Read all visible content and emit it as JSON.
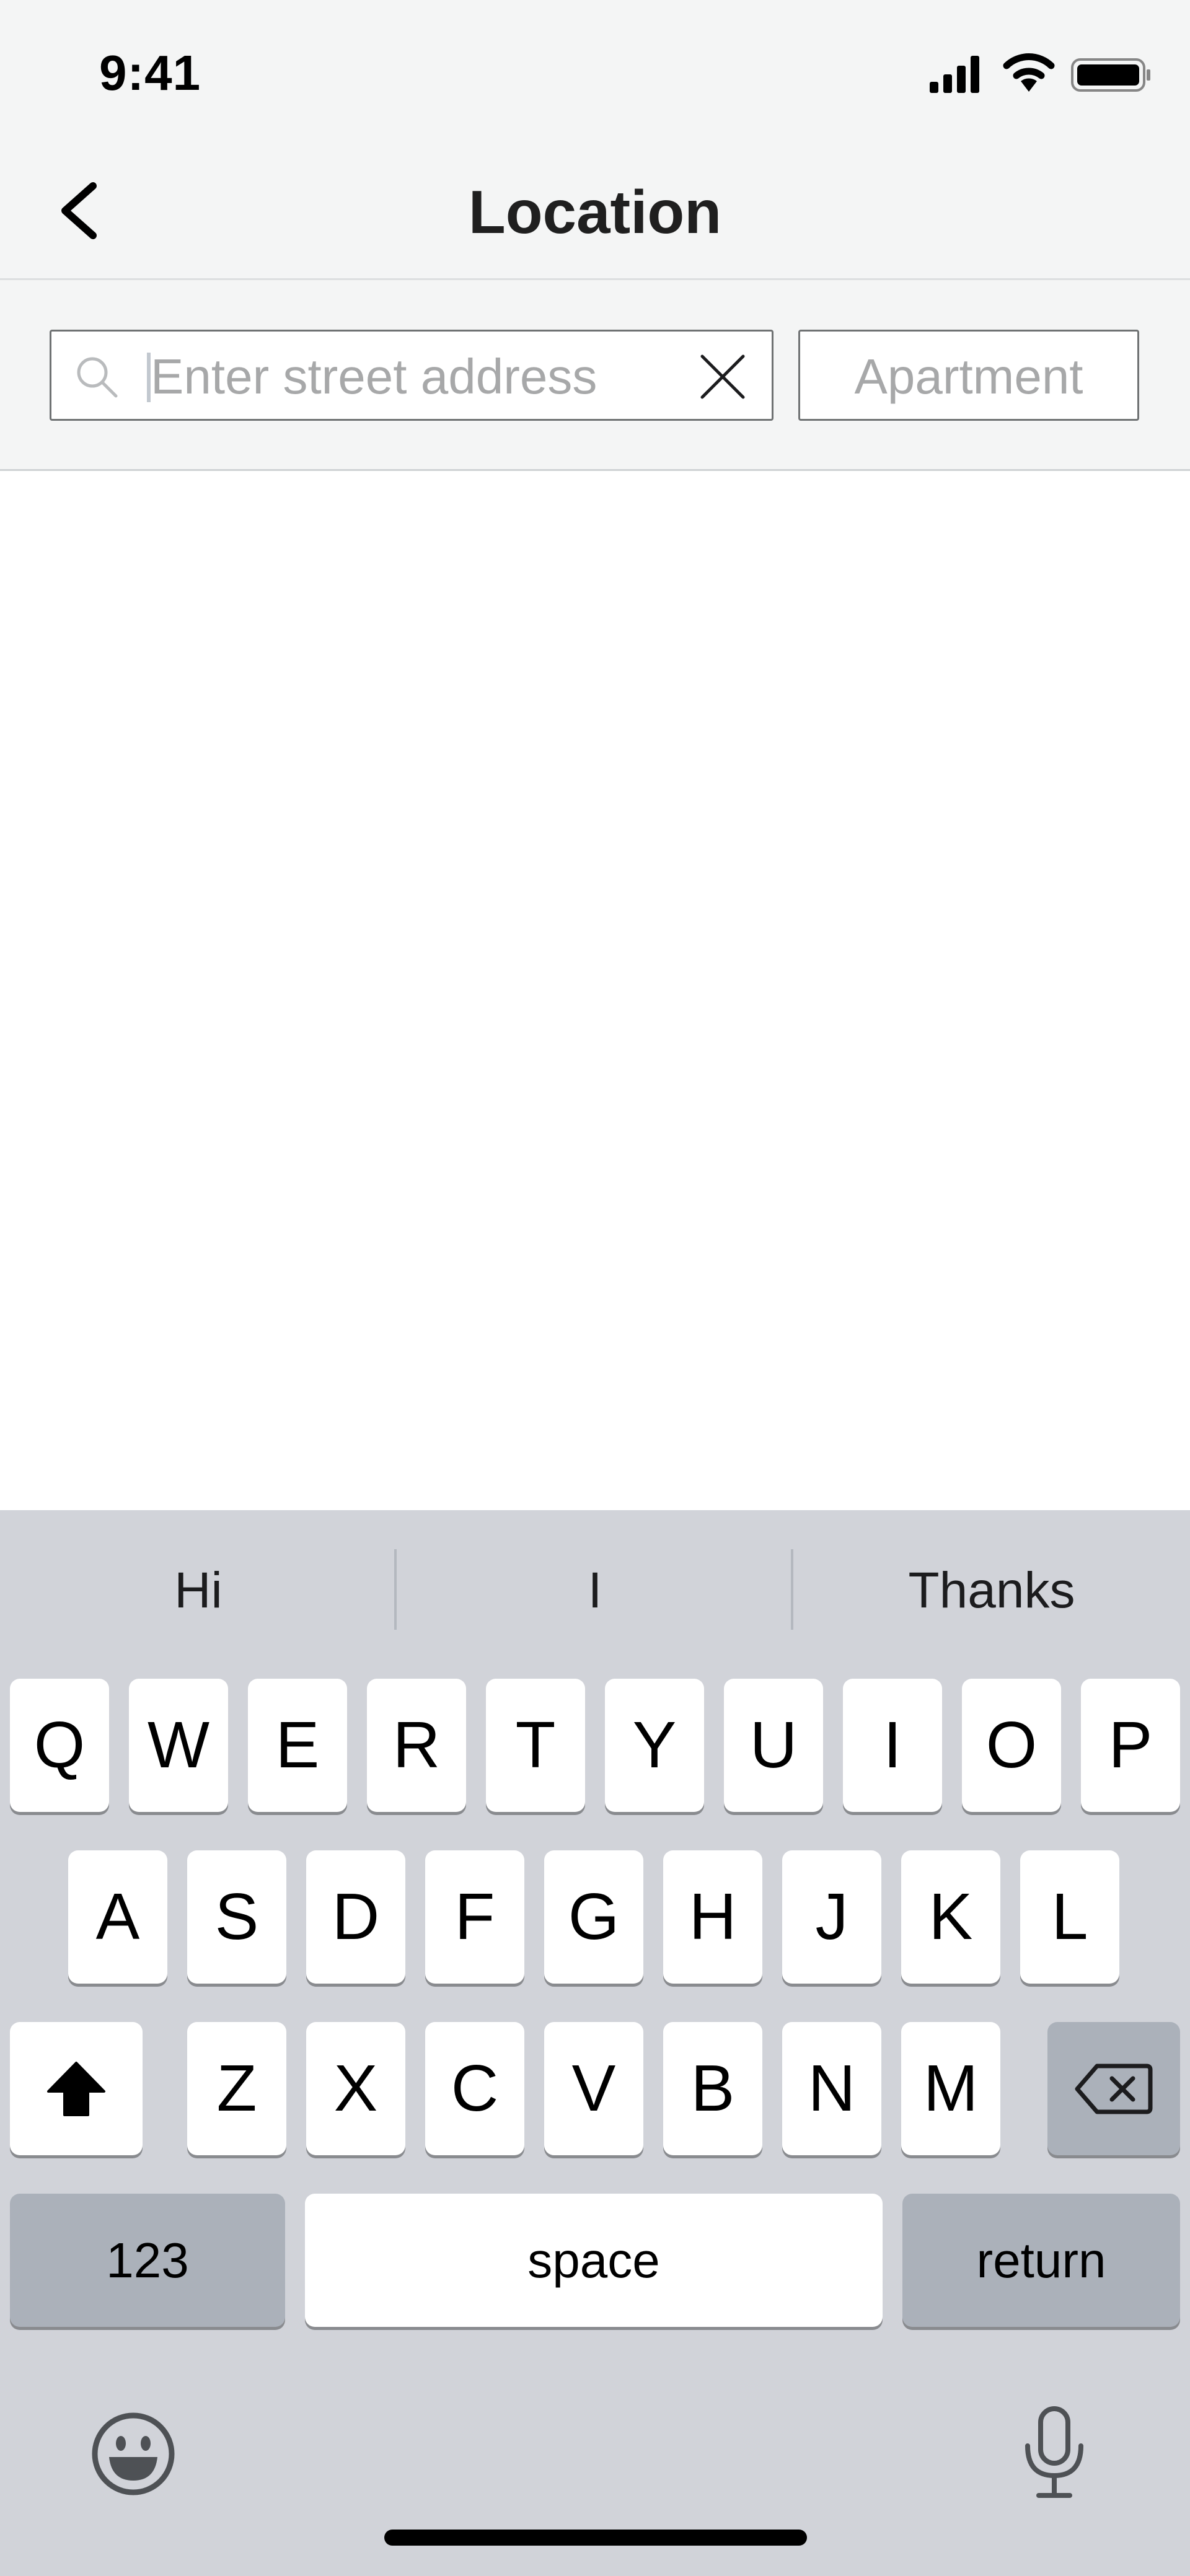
{
  "status_bar": {
    "time": "9:41",
    "icons": [
      "cellular-signal-icon",
      "wifi-icon",
      "battery-icon"
    ]
  },
  "nav": {
    "title": "Location",
    "back_icon": "chevron-left-icon"
  },
  "search": {
    "street_placeholder": "Enter street address",
    "street_value": "",
    "apartment_placeholder": "Apartment",
    "apartment_value": "",
    "search_icon": "magnifier-icon",
    "clear_icon": "x-icon"
  },
  "keyboard": {
    "suggestions": [
      "Hi",
      "I",
      "Thanks"
    ],
    "row1": [
      "Q",
      "W",
      "E",
      "R",
      "T",
      "Y",
      "U",
      "I",
      "O",
      "P"
    ],
    "row2": [
      "A",
      "S",
      "D",
      "F",
      "G",
      "H",
      "J",
      "K",
      "L"
    ],
    "row3": [
      "Z",
      "X",
      "C",
      "V",
      "B",
      "N",
      "M"
    ],
    "numbers_label": "123",
    "space_label": "space",
    "return_label": "return",
    "shift_icon": "shift-icon",
    "delete_icon": "delete-icon",
    "emoji_icon": "emoji-icon",
    "mic_icon": "microphone-icon"
  },
  "colors": {
    "bar_background": "#f4f5f5",
    "keyboard_background": "#d1d3d9",
    "dark_key": "#abb1ba",
    "placeholder": "#a7a8a9"
  }
}
